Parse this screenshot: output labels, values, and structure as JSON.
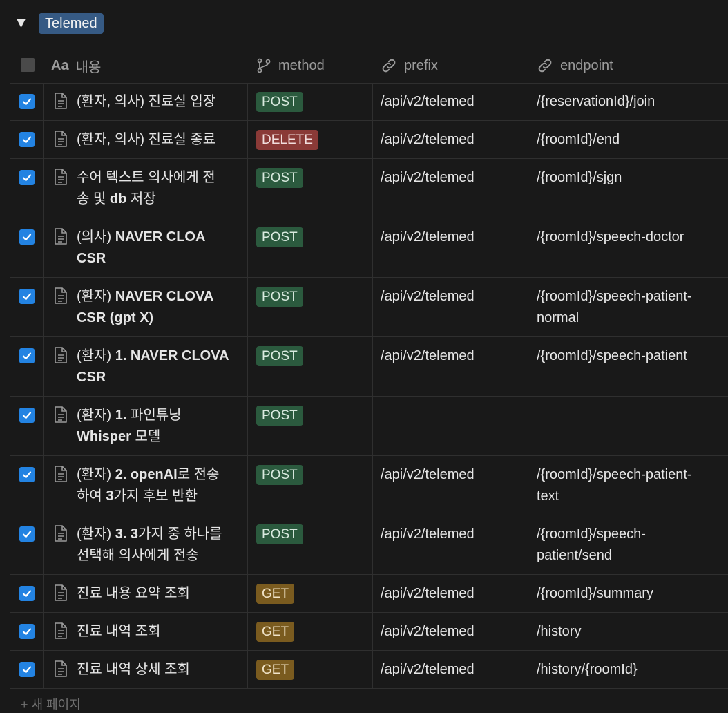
{
  "group": {
    "toggle_glyph": "▼",
    "tag": "Telemed",
    "tag_color": "#365a84"
  },
  "columns": {
    "title": "내용",
    "title_icon": "Aa",
    "method": "method",
    "prefix": "prefix",
    "endpoint": "endpoint"
  },
  "method_colors": {
    "POST": "#2b5a3e",
    "DELETE": "#8a3a37",
    "GET": "#7a5b1f"
  },
  "rows": [
    {
      "lines": [
        [
          {
            "t": "(환자, 의사) 진료실 입장",
            "b": false
          }
        ]
      ],
      "method": "POST",
      "prefix": "/api/v2/telemed",
      "endpoint": [
        "/{reservationId}/join"
      ],
      "checked": true
    },
    {
      "lines": [
        [
          {
            "t": "(환자, 의사) 진료실 종료",
            "b": false
          }
        ]
      ],
      "method": "DELETE",
      "prefix": "/api/v2/telemed",
      "endpoint": [
        "/{roomId}/end"
      ],
      "checked": true
    },
    {
      "lines": [
        [
          {
            "t": "수어 텍스트 의사에게 전",
            "b": false
          }
        ],
        [
          {
            "t": "송 및 ",
            "b": false
          },
          {
            "t": "db",
            "b": true
          },
          {
            "t": " 저장",
            "b": false
          }
        ]
      ],
      "method": "POST",
      "prefix": "/api/v2/telemed",
      "endpoint": [
        "/{roomId}/sjgn"
      ],
      "checked": true
    },
    {
      "lines": [
        [
          {
            "t": "(의사) ",
            "b": false
          },
          {
            "t": "NAVER CLOA",
            "b": true
          }
        ],
        [
          {
            "t": "CSR",
            "b": true
          }
        ]
      ],
      "method": "POST",
      "prefix": "/api/v2/telemed",
      "endpoint": [
        "/{roomId}/speech-doctor"
      ],
      "checked": true
    },
    {
      "lines": [
        [
          {
            "t": "(환자) ",
            "b": false
          },
          {
            "t": "NAVER CLOVA",
            "b": true
          }
        ],
        [
          {
            "t": "CSR (gpt X)",
            "b": true
          }
        ]
      ],
      "method": "POST",
      "prefix": "/api/v2/telemed",
      "endpoint": [
        "/{roomId}/speech-patient-",
        "normal"
      ],
      "checked": true
    },
    {
      "lines": [
        [
          {
            "t": "(환자) ",
            "b": false
          },
          {
            "t": "1. NAVER CLOVA",
            "b": true
          }
        ],
        [
          {
            "t": "CSR",
            "b": true
          }
        ]
      ],
      "method": "POST",
      "prefix": "/api/v2/telemed",
      "endpoint": [
        "/{roomId}/speech-patient"
      ],
      "checked": true
    },
    {
      "lines": [
        [
          {
            "t": "(환자) ",
            "b": false
          },
          {
            "t": "1.",
            "b": true
          },
          {
            "t": " 파인튜닝",
            "b": false
          }
        ],
        [
          {
            "t": "Whisper",
            "b": true
          },
          {
            "t": " 모델",
            "b": false
          }
        ]
      ],
      "method": "POST",
      "prefix": "",
      "endpoint": [],
      "checked": true
    },
    {
      "lines": [
        [
          {
            "t": "(환자) ",
            "b": false
          },
          {
            "t": "2. openAI",
            "b": true
          },
          {
            "t": "로 전송",
            "b": false
          }
        ],
        [
          {
            "t": "하여 ",
            "b": false
          },
          {
            "t": "3",
            "b": true
          },
          {
            "t": "가지 후보 반환",
            "b": false
          }
        ]
      ],
      "method": "POST",
      "prefix": "/api/v2/telemed",
      "endpoint": [
        "/{roomId}/speech-patient-",
        "text"
      ],
      "checked": true
    },
    {
      "lines": [
        [
          {
            "t": "(환자) ",
            "b": false
          },
          {
            "t": "3. 3",
            "b": true
          },
          {
            "t": "가지 중 하나를",
            "b": false
          }
        ],
        [
          {
            "t": "선택해 의사에게 전송",
            "b": false
          }
        ]
      ],
      "method": "POST",
      "prefix": "/api/v2/telemed",
      "endpoint": [
        "/{roomId}/speech-",
        "patient/send"
      ],
      "checked": true
    },
    {
      "lines": [
        [
          {
            "t": "진료 내용 요약 조회",
            "b": false
          }
        ]
      ],
      "method": "GET",
      "prefix": "/api/v2/telemed",
      "endpoint": [
        "/{roomId}/summary"
      ],
      "checked": true
    },
    {
      "lines": [
        [
          {
            "t": "진료 내역 조회",
            "b": false
          }
        ]
      ],
      "method": "GET",
      "prefix": "/api/v2/telemed",
      "endpoint": [
        "/history"
      ],
      "checked": true
    },
    {
      "lines": [
        [
          {
            "t": "진료 내역 상세 조회",
            "b": false
          }
        ]
      ],
      "method": "GET",
      "prefix": "/api/v2/telemed",
      "endpoint": [
        "/history/{roomId}"
      ],
      "checked": true
    }
  ],
  "footer": {
    "new_row": "+ 새 페이지"
  }
}
